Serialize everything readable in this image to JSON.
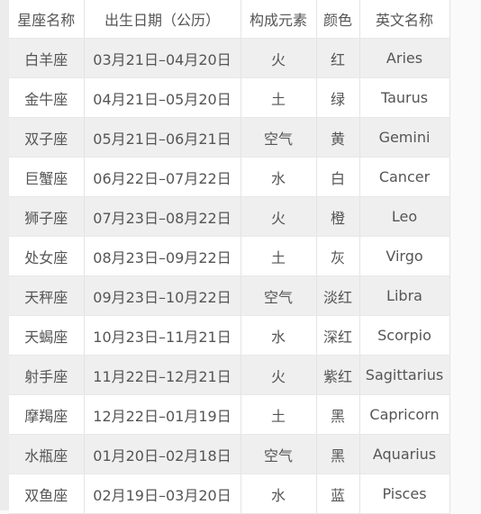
{
  "headers": [
    "星座名称",
    "出生日期（公历）",
    "构成元素",
    "颜色",
    "英文名称"
  ],
  "rows": [
    [
      "白羊座",
      "03月21日–04月20日",
      "火",
      "红",
      "Aries"
    ],
    [
      "金牛座",
      "04月21日–05月20日",
      "土",
      "绿",
      "Taurus"
    ],
    [
      "双子座",
      "05月21日–06月21日",
      "空气",
      "黄",
      "Gemini"
    ],
    [
      "巨蟹座",
      "06月22日–07月22日",
      "水",
      "白",
      "Cancer"
    ],
    [
      "狮子座",
      "07月23日–08月22日",
      "火",
      "橙",
      "Leo"
    ],
    [
      "处女座",
      "08月23日–09月22日",
      "土",
      "灰",
      "Virgo"
    ],
    [
      "天秤座",
      "09月23日–10月22日",
      "空气",
      "淡红",
      "Libra"
    ],
    [
      "天蝎座",
      "10月23日–11月21日",
      "水",
      "深红",
      "Scorpio"
    ],
    [
      "射手座",
      "11月22日–12月21日",
      "火",
      "紫红",
      "Sagittarius"
    ],
    [
      "摩羯座",
      "12月22日–01月19日",
      "土",
      "黑",
      "Capricorn"
    ],
    [
      "水瓶座",
      "01月20日–02月18日",
      "空气",
      "黑",
      "Aquarius"
    ],
    [
      "双鱼座",
      "02月19日–03月20日",
      "水",
      "蓝",
      "Pisces"
    ]
  ]
}
